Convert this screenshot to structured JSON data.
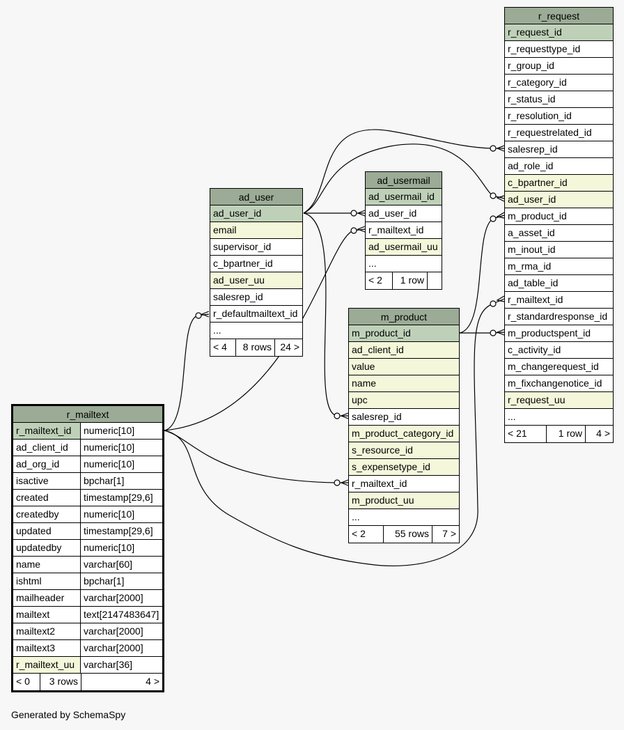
{
  "footer": "Generated by SchemaSpy",
  "colors": {
    "background": "#f7f7f7",
    "header": "#9bab96",
    "pk": "#bed1b8",
    "indexed": "#f4f7da",
    "plain": "#ffffff"
  },
  "ad_user": {
    "title": "ad_user",
    "rows": [
      {
        "name": "ad_user_id",
        "kind": "pk"
      },
      {
        "name": "email",
        "kind": "idx"
      },
      {
        "name": "supervisor_id",
        "kind": "plain"
      },
      {
        "name": "c_bpartner_id",
        "kind": "plain"
      },
      {
        "name": "ad_user_uu",
        "kind": "idx"
      },
      {
        "name": "salesrep_id",
        "kind": "plain"
      },
      {
        "name": "r_defaultmailtext_id",
        "kind": "plain"
      },
      {
        "name": "...",
        "kind": "plain"
      }
    ],
    "footer": {
      "left": "< 4",
      "center": "8 rows",
      "right": "24 >"
    }
  },
  "ad_usermail": {
    "title": "ad_usermail",
    "rows": [
      {
        "name": "ad_usermail_id",
        "kind": "pk"
      },
      {
        "name": "ad_user_id",
        "kind": "plain"
      },
      {
        "name": "r_mailtext_id",
        "kind": "plain"
      },
      {
        "name": "ad_usermail_uu",
        "kind": "idx"
      },
      {
        "name": "...",
        "kind": "plain"
      }
    ],
    "footer": {
      "left": "< 2",
      "center": "1 row",
      "right": ""
    }
  },
  "m_product": {
    "title": "m_product",
    "rows": [
      {
        "name": "m_product_id",
        "kind": "pk"
      },
      {
        "name": "ad_client_id",
        "kind": "idx"
      },
      {
        "name": "value",
        "kind": "idx"
      },
      {
        "name": "name",
        "kind": "idx"
      },
      {
        "name": "upc",
        "kind": "idx"
      },
      {
        "name": "salesrep_id",
        "kind": "plain"
      },
      {
        "name": "m_product_category_id",
        "kind": "idx"
      },
      {
        "name": "s_resource_id",
        "kind": "idx"
      },
      {
        "name": "s_expensetype_id",
        "kind": "idx"
      },
      {
        "name": "r_mailtext_id",
        "kind": "plain"
      },
      {
        "name": "m_product_uu",
        "kind": "idx"
      },
      {
        "name": "...",
        "kind": "plain"
      }
    ],
    "footer": {
      "left": "< 2",
      "center": "55 rows",
      "right": "7 >"
    }
  },
  "r_request": {
    "title": "r_request",
    "rows": [
      {
        "name": "r_request_id",
        "kind": "pk"
      },
      {
        "name": "r_requesttype_id",
        "kind": "plain"
      },
      {
        "name": "r_group_id",
        "kind": "plain"
      },
      {
        "name": "r_category_id",
        "kind": "plain"
      },
      {
        "name": "r_status_id",
        "kind": "plain"
      },
      {
        "name": "r_resolution_id",
        "kind": "plain"
      },
      {
        "name": "r_requestrelated_id",
        "kind": "plain"
      },
      {
        "name": "salesrep_id",
        "kind": "plain"
      },
      {
        "name": "ad_role_id",
        "kind": "plain"
      },
      {
        "name": "c_bpartner_id",
        "kind": "idx"
      },
      {
        "name": "ad_user_id",
        "kind": "idx"
      },
      {
        "name": "m_product_id",
        "kind": "plain"
      },
      {
        "name": "a_asset_id",
        "kind": "plain"
      },
      {
        "name": "m_inout_id",
        "kind": "plain"
      },
      {
        "name": "m_rma_id",
        "kind": "plain"
      },
      {
        "name": "ad_table_id",
        "kind": "plain"
      },
      {
        "name": "r_mailtext_id",
        "kind": "plain"
      },
      {
        "name": "r_standardresponse_id",
        "kind": "plain"
      },
      {
        "name": "m_productspent_id",
        "kind": "plain"
      },
      {
        "name": "c_activity_id",
        "kind": "plain"
      },
      {
        "name": "m_changerequest_id",
        "kind": "plain"
      },
      {
        "name": "m_fixchangenotice_id",
        "kind": "plain"
      },
      {
        "name": "r_request_uu",
        "kind": "idx"
      },
      {
        "name": "...",
        "kind": "plain"
      }
    ],
    "footer": {
      "left": "< 21",
      "center": "1 row",
      "right": "4 >"
    }
  },
  "r_mailtext": {
    "title": "r_mailtext",
    "rows": [
      {
        "name": "r_mailtext_id",
        "type": "numeric[10]",
        "kind": "pk"
      },
      {
        "name": "ad_client_id",
        "type": "numeric[10]",
        "kind": "plain"
      },
      {
        "name": "ad_org_id",
        "type": "numeric[10]",
        "kind": "plain"
      },
      {
        "name": "isactive",
        "type": "bpchar[1]",
        "kind": "plain"
      },
      {
        "name": "created",
        "type": "timestamp[29,6]",
        "kind": "plain"
      },
      {
        "name": "createdby",
        "type": "numeric[10]",
        "kind": "plain"
      },
      {
        "name": "updated",
        "type": "timestamp[29,6]",
        "kind": "plain"
      },
      {
        "name": "updatedby",
        "type": "numeric[10]",
        "kind": "plain"
      },
      {
        "name": "name",
        "type": "varchar[60]",
        "kind": "plain"
      },
      {
        "name": "ishtml",
        "type": "bpchar[1]",
        "kind": "plain"
      },
      {
        "name": "mailheader",
        "type": "varchar[2000]",
        "kind": "plain"
      },
      {
        "name": "mailtext",
        "type": "text[2147483647]",
        "kind": "plain"
      },
      {
        "name": "mailtext2",
        "type": "varchar[2000]",
        "kind": "plain"
      },
      {
        "name": "mailtext3",
        "type": "varchar[2000]",
        "kind": "plain"
      },
      {
        "name": "r_mailtext_uu",
        "type": "varchar[36]",
        "kind": "idx"
      }
    ],
    "footer": {
      "left": "< 0",
      "center": "3 rows",
      "right": "4 >"
    }
  }
}
